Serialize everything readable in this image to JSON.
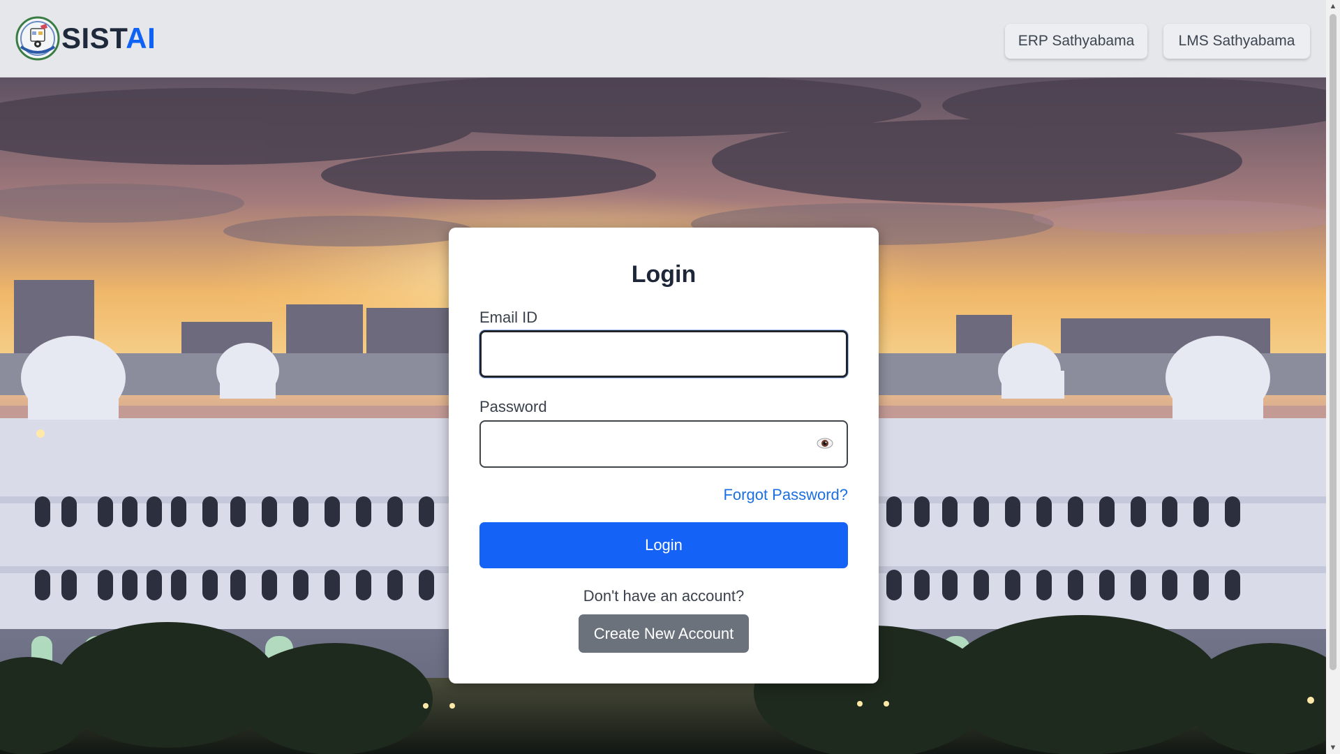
{
  "brand": {
    "part1": "SIST",
    "part2": "AI"
  },
  "nav": {
    "erp_label": "ERP Sathyabama",
    "lms_label": "LMS Sathyabama"
  },
  "login": {
    "title": "Login",
    "email_label": "Email ID",
    "email_value": "",
    "password_label": "Password",
    "password_value": "",
    "forgot_label": "Forgot Password?",
    "submit_label": "Login",
    "no_account_text": "Don't have an account?",
    "create_label": "Create New Account"
  },
  "colors": {
    "brand_dark": "#1e2a3b",
    "brand_accent": "#1062f5",
    "primary_button": "#1562f7",
    "secondary_button": "#6b727b",
    "link": "#1c6fe0"
  },
  "icons": {
    "eye": "eye-icon",
    "logo": "university-seal-logo"
  },
  "background": "campus-building-sunset-photo"
}
